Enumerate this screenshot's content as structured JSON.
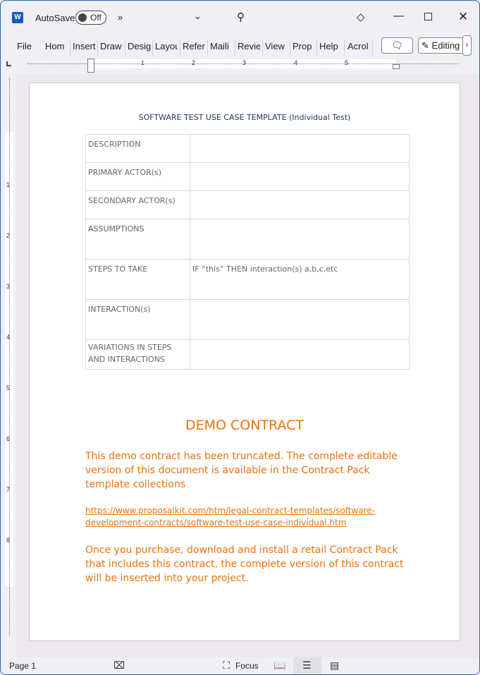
{
  "titlebar": {
    "autosave_label": "AutoSave",
    "autosave_state": "Off",
    "overflow": "»"
  },
  "ribbon": {
    "tabs": [
      "File",
      "Home",
      "Insert",
      "Draw",
      "Design",
      "Layout",
      "References",
      "Mailings",
      "Review",
      "View",
      "Properties",
      "Help",
      "Acrobat"
    ],
    "tabs_visible": [
      "File",
      "Hom",
      "Insert",
      "Draw",
      "Desig",
      "Layou",
      "Refer",
      "Maili",
      "Revie",
      "View",
      "Prop",
      "Help",
      "Acrol"
    ],
    "editing_label": "Editing"
  },
  "ruler": {
    "numbers": [
      "1",
      "2",
      "3",
      "4",
      "5"
    ],
    "vnumbers": [
      "1",
      "2",
      "3",
      "4",
      "5",
      "6",
      "7",
      "8"
    ]
  },
  "document": {
    "title": "SOFTWARE TEST USE CASE TEMPLATE (Individual Test)",
    "table": [
      {
        "label": "DESCRIPTION",
        "value": ""
      },
      {
        "label": "PRIMARY ACTOR(s)",
        "value": ""
      },
      {
        "label": "SECONDARY ACTOR(s)",
        "value": ""
      },
      {
        "label": "ASSUMPTIONS",
        "value": ""
      },
      {
        "label": "STEPS TO TAKE",
        "value": "IF “this” THEN interaction(s) a,b,c,etc"
      },
      {
        "label": "INTERACTION(s)",
        "value": ""
      },
      {
        "label": "VARIATIONS IN STEPS AND INTERACTIONS",
        "value": ""
      }
    ],
    "demo_heading": "DEMO CONTRACT",
    "demo_p1": "This demo contract has been truncated. The complete editable version of this document is available in the Contract Pack template collections",
    "demo_link": "https://www.proposalkit.com/htm/legal-contract-templates/software-development-contracts/software-test-use-case-individual.htm",
    "demo_p2": "Once you purchase, download and install a retail Contract Pack that includes this contract, the complete version of this contract will be inserted into your project.",
    "accent_color": "#e8730c"
  },
  "status": {
    "page": "Page 1",
    "focus": "Focus"
  }
}
